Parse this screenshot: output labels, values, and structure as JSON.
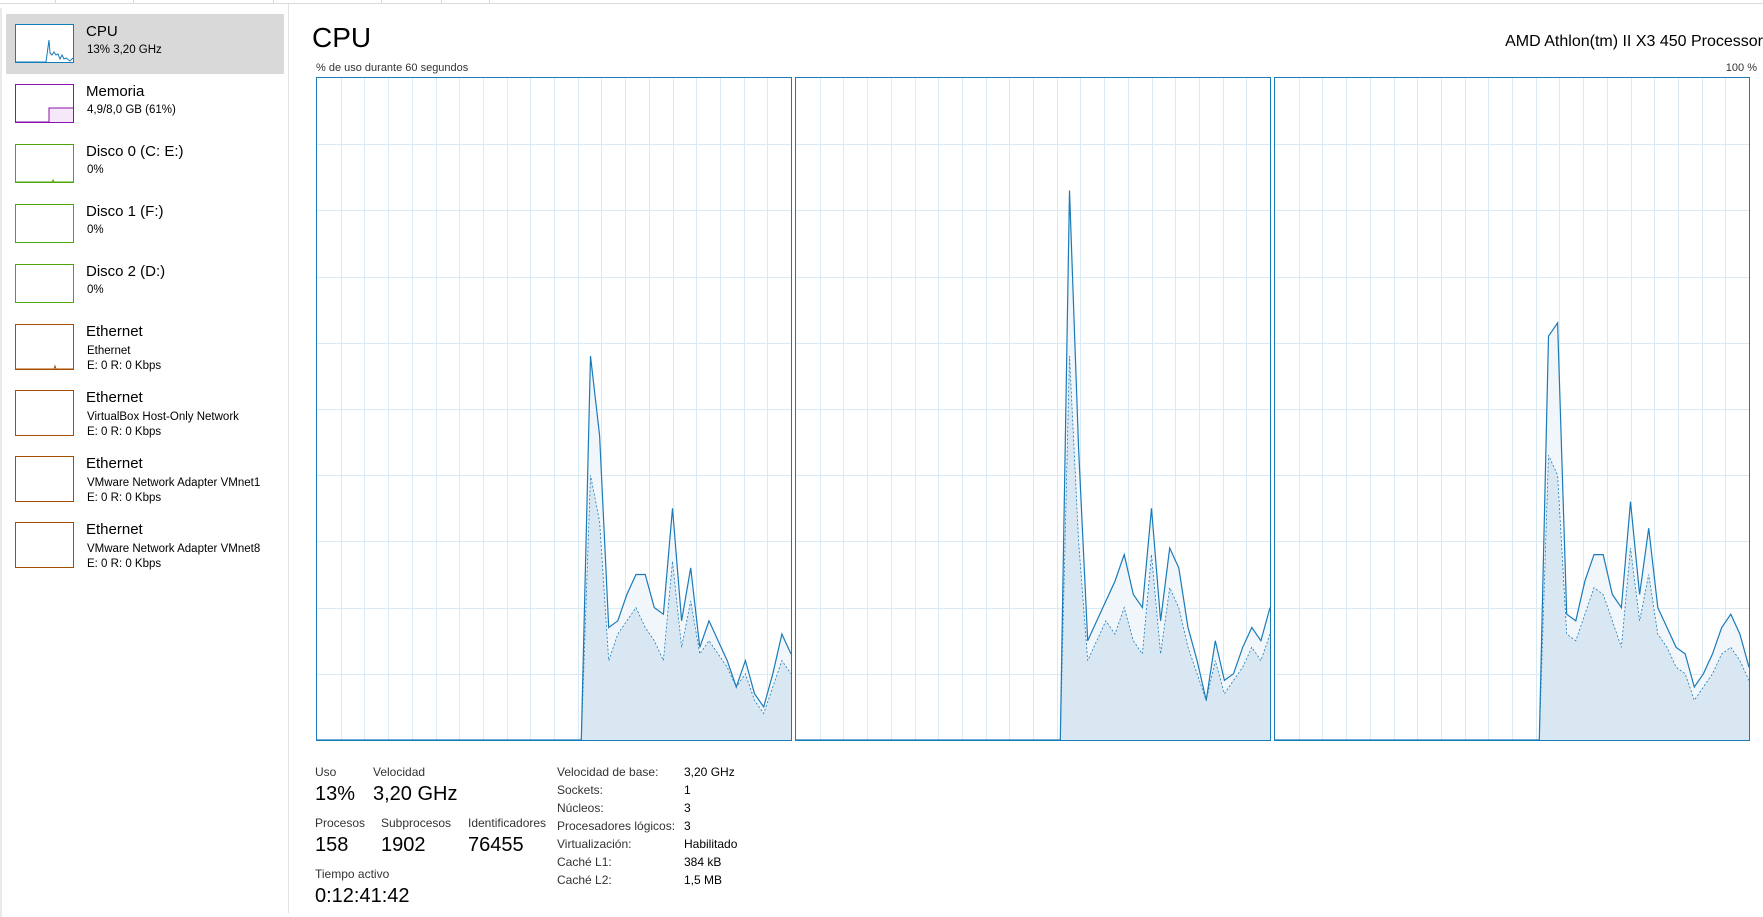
{
  "sidebar": {
    "items": [
      {
        "title": "CPU",
        "sub1": "13% 3,20 GHz",
        "sub2": "",
        "color": "#117dbb",
        "selected": true
      },
      {
        "title": "Memoria",
        "sub1": "4,9/8,0 GB (61%)",
        "sub2": "",
        "color": "#8b12ae",
        "selected": false
      },
      {
        "title": "Disco 0 (C: E:)",
        "sub1": "0%",
        "sub2": "",
        "color": "#4da60c",
        "selected": false
      },
      {
        "title": "Disco 1 (F:)",
        "sub1": "0%",
        "sub2": "",
        "color": "#4da60c",
        "selected": false
      },
      {
        "title": "Disco 2 (D:)",
        "sub1": "0%",
        "sub2": "",
        "color": "#4da60c",
        "selected": false
      },
      {
        "title": "Ethernet",
        "sub1": "Ethernet",
        "sub2": "E: 0 R: 0 Kbps",
        "color": "#a74f01",
        "selected": false
      },
      {
        "title": "Ethernet",
        "sub1": "VirtualBox Host-Only Network",
        "sub2": "E: 0 R: 0 Kbps",
        "color": "#a74f01",
        "selected": false
      },
      {
        "title": "Ethernet",
        "sub1": "VMware Network Adapter VMnet1",
        "sub2": "E: 0 R: 0 Kbps",
        "color": "#a74f01",
        "selected": false
      },
      {
        "title": "Ethernet",
        "sub1": "VMware Network Adapter VMnet8",
        "sub2": "E: 0 R: 0 Kbps",
        "color": "#a74f01",
        "selected": false
      }
    ]
  },
  "header": {
    "title": "CPU",
    "processor": "AMD Athlon(tm) II X3 450 Processor",
    "axis_caption": "% de uso durante 60 segundos",
    "axis_max": "100 %"
  },
  "graphs": {
    "line_color": "#1a7bb9",
    "fill_color": "#d8e7f1",
    "grid_color": "#d9eaf4",
    "cores": [
      {
        "name": "core-0",
        "total": [
          0,
          0,
          0,
          0,
          0,
          0,
          0,
          0,
          0,
          0,
          0,
          0,
          0,
          0,
          0,
          0,
          0,
          0,
          0,
          0,
          0,
          0,
          0,
          0,
          0,
          0,
          0,
          0,
          0,
          0,
          58,
          46,
          17,
          18,
          22,
          25,
          25,
          20,
          19,
          35,
          18,
          26,
          14,
          18,
          15,
          12,
          8,
          12,
          7,
          5,
          10,
          16,
          13
        ],
        "kernel": [
          0,
          0,
          0,
          0,
          0,
          0,
          0,
          0,
          0,
          0,
          0,
          0,
          0,
          0,
          0,
          0,
          0,
          0,
          0,
          0,
          0,
          0,
          0,
          0,
          0,
          0,
          0,
          0,
          0,
          0,
          40,
          33,
          12,
          16,
          18,
          20,
          17,
          15,
          12,
          27,
          14,
          21,
          13,
          15,
          13,
          11,
          8,
          10,
          6,
          4,
          8,
          12,
          10
        ]
      },
      {
        "name": "core-1",
        "total": [
          0,
          0,
          0,
          0,
          0,
          0,
          0,
          0,
          0,
          0,
          0,
          0,
          0,
          0,
          0,
          0,
          0,
          0,
          0,
          0,
          0,
          0,
          0,
          0,
          0,
          0,
          0,
          0,
          0,
          0,
          83,
          44,
          15,
          18,
          21,
          24,
          28,
          22,
          20,
          35,
          18,
          29,
          26,
          17,
          12,
          6,
          15,
          9,
          10,
          14,
          17,
          15,
          20
        ],
        "kernel": [
          0,
          0,
          0,
          0,
          0,
          0,
          0,
          0,
          0,
          0,
          0,
          0,
          0,
          0,
          0,
          0,
          0,
          0,
          0,
          0,
          0,
          0,
          0,
          0,
          0,
          0,
          0,
          0,
          0,
          0,
          58,
          30,
          12,
          15,
          18,
          16,
          20,
          15,
          13,
          28,
          13,
          23,
          20,
          14,
          10,
          6,
          12,
          7,
          9,
          11,
          14,
          12,
          16
        ]
      },
      {
        "name": "core-2",
        "total": [
          0,
          0,
          0,
          0,
          0,
          0,
          0,
          0,
          0,
          0,
          0,
          0,
          0,
          0,
          0,
          0,
          0,
          0,
          0,
          0,
          0,
          0,
          0,
          0,
          0,
          0,
          0,
          0,
          0,
          0,
          61,
          63,
          19,
          18,
          24,
          28,
          28,
          22,
          20,
          36,
          22,
          32,
          20,
          17,
          14,
          13,
          8,
          10,
          13,
          17,
          19,
          16,
          11
        ],
        "kernel": [
          0,
          0,
          0,
          0,
          0,
          0,
          0,
          0,
          0,
          0,
          0,
          0,
          0,
          0,
          0,
          0,
          0,
          0,
          0,
          0,
          0,
          0,
          0,
          0,
          0,
          0,
          0,
          0,
          0,
          0,
          43,
          40,
          16,
          15,
          19,
          23,
          22,
          18,
          14,
          29,
          18,
          25,
          16,
          14,
          11,
          10,
          6,
          8,
          10,
          13,
          14,
          12,
          9
        ]
      }
    ]
  },
  "stats": {
    "uso_label": "Uso",
    "uso_value": "13%",
    "velocidad_label": "Velocidad",
    "velocidad_value": "3,20 GHz",
    "procesos_label": "Procesos",
    "procesos_value": "158",
    "subprocesos_label": "Subprocesos",
    "subprocesos_value": "1902",
    "identificadores_label": "Identificadores",
    "identificadores_value": "76455",
    "tiempo_label": "Tiempo activo",
    "tiempo_value": "0:12:41:42"
  },
  "details": [
    {
      "label": "Velocidad de base:",
      "value": "3,20 GHz"
    },
    {
      "label": "Sockets:",
      "value": "1"
    },
    {
      "label": "Núcleos:",
      "value": "3"
    },
    {
      "label": "Procesadores lógicos:",
      "value": "3"
    },
    {
      "label": "Virtualización:",
      "value": "Habilitado"
    },
    {
      "label": "Caché L1:",
      "value": "384 kB"
    },
    {
      "label": "Caché L2:",
      "value": "1,5 MB"
    }
  ]
}
